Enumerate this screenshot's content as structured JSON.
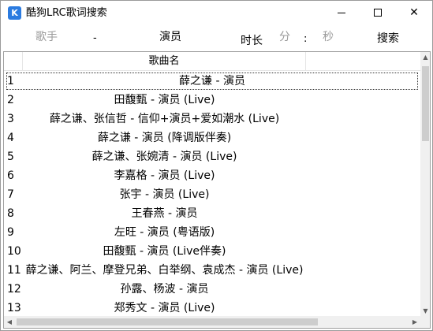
{
  "window": {
    "title": "酷狗LRC歌词搜索",
    "app_icon_letter": "K",
    "minimize_symbol": "—",
    "close_symbol": "✕"
  },
  "search": {
    "artist_placeholder": "歌手",
    "dash": "-",
    "title_value": "演员",
    "duration_label": "时长",
    "minutes_placeholder": "分",
    "colon": ":",
    "seconds_placeholder": "秒",
    "search_button_label": "搜索"
  },
  "list": {
    "column_header": "歌曲名",
    "selected_index": 0,
    "rows": [
      {
        "num": "1",
        "song": "薛之谦 - 演员"
      },
      {
        "num": "2",
        "song": "田馥甄 - 演员 (Live)"
      },
      {
        "num": "3",
        "song": "薛之谦、张信哲 - 信仰+演员+爱如潮水 (Live)"
      },
      {
        "num": "4",
        "song": "薛之谦 - 演员 (降调版伴奏)"
      },
      {
        "num": "5",
        "song": "薛之谦、张婉清 - 演员 (Live)"
      },
      {
        "num": "6",
        "song": "李嘉格 - 演员 (Live)"
      },
      {
        "num": "7",
        "song": "张宇 - 演员 (Live)"
      },
      {
        "num": "8",
        "song": "王春燕 - 演员"
      },
      {
        "num": "9",
        "song": "左旺 - 演员 (粤语版)"
      },
      {
        "num": "10",
        "song": "田馥甄 - 演员 (Live伴奏)"
      },
      {
        "num": "11",
        "song": "薛之谦、阿兰、摩登兄弟、白举纲、袁成杰 - 演员 (Live)"
      },
      {
        "num": "12",
        "song": "孙露、杨波 - 演员"
      },
      {
        "num": "13",
        "song": "郑秀文 - 演员 (Live)"
      }
    ]
  },
  "scrollbars": {
    "up_arrow": "▲",
    "down_arrow": "▼",
    "left_arrow": "◀",
    "right_arrow": "▶"
  }
}
